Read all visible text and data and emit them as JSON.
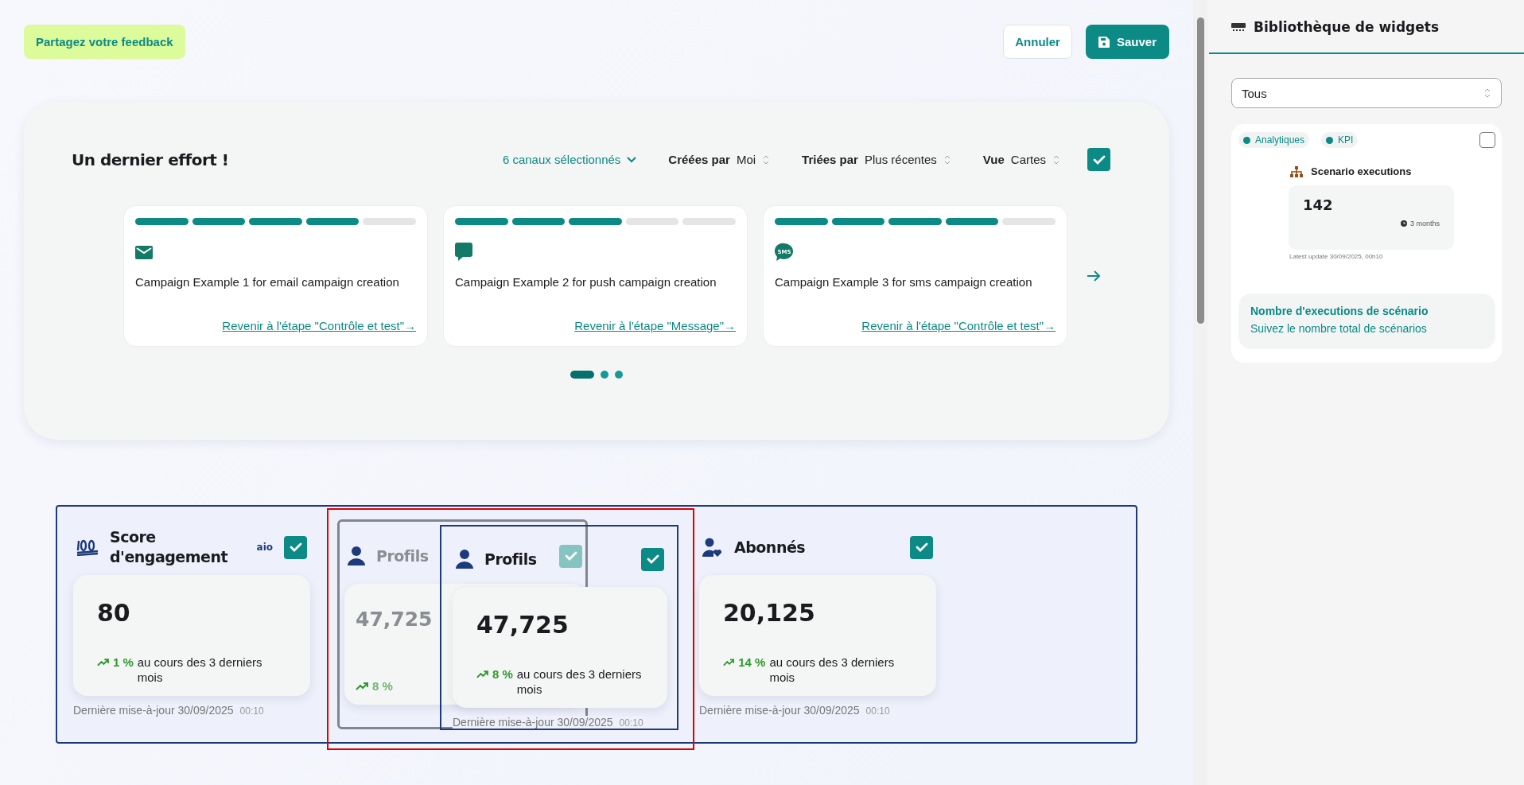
{
  "toolbar": {
    "feedback": "Partagez votre feedback",
    "cancel": "Annuler",
    "save": "Sauver"
  },
  "campaigns_panel": {
    "title": "Un dernier effort !",
    "channels": "6 canaux sélectionnés",
    "filters": [
      {
        "label": "Créées par",
        "value": "Moi"
      },
      {
        "label": "Triées par",
        "value": "Plus récentes"
      },
      {
        "label": "Vue",
        "value": "Cartes"
      }
    ],
    "checked": true,
    "cards": [
      {
        "kind": "email",
        "level": 0.8,
        "name": "Campaign Example 1 for email campaign creation",
        "link": "Revenir à l'étape \"Contrôle et test\"→"
      },
      {
        "kind": "push",
        "level": 0.6,
        "name": "Campaign Example 2 for push campaign creation",
        "link": "Revenir à l'étape \"Message\"→"
      },
      {
        "kind": "sms",
        "icon_label": "SMS",
        "level": 0.8,
        "name": "Campaign Example 3 for sms campaign creation",
        "link": "Revenir à l'étape \"Contrôle et test\"→"
      }
    ],
    "pager": [
      {
        "selected": true
      },
      {
        "selected": false
      },
      {
        "selected": false
      }
    ]
  },
  "widgets": [
    {
      "kind": "score",
      "title": "Score d'engagement",
      "badge": "aio",
      "checked": true,
      "value": "80",
      "trend": "1 %",
      "trend_text": "au cours des 3 derniers mois",
      "updated": "Dernière mise-à-jour 30/09/2025",
      "time": "00:10"
    },
    {
      "kind": "placeholder",
      "title": "Profils",
      "checked": true,
      "value": "47,725",
      "trend": "8 %"
    },
    {
      "kind": "subscribers",
      "title": "Abonnés",
      "checked": true,
      "value": "20,125",
      "trend": "14 %",
      "trend_text": "au cours des 3 derniers mois",
      "updated": "Dernière mise-à-jour 30/09/2025",
      "time": "00:10"
    }
  ],
  "dragged_widget": {
    "kind": "profiles",
    "title": "Profils",
    "checked": true,
    "value": "47,725",
    "trend": "8 %",
    "trend_text": "au cours des 3 derniers mois",
    "updated": "Dernière mise-à-jour 30/09/2025",
    "time": "00:10"
  },
  "library": {
    "title": "Bibliothèque de widgets",
    "filter": "Tous",
    "item": {
      "tags": [
        "Analytiques",
        "KPI"
      ],
      "checked": false,
      "preview_title": "Scenario executions",
      "value": "142",
      "period": "3 months",
      "updated": "Latest update 30/09/2025, 00h10",
      "name": "Nombre d'executions de scénario",
      "description": "Suivez le nombre total de scénarios"
    }
  }
}
